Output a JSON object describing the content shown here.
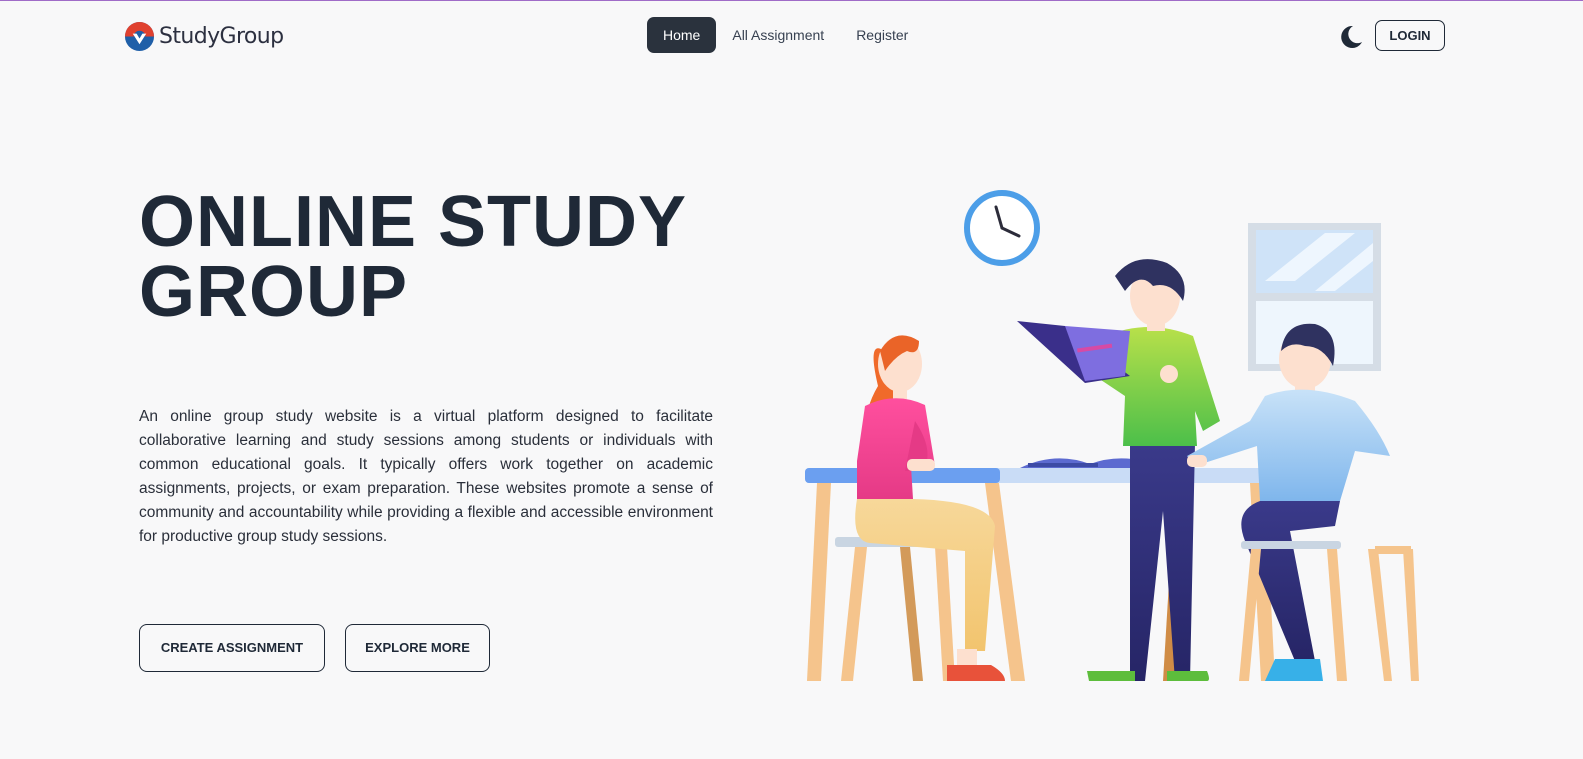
{
  "navbar": {
    "logo_text": "StudyGroup",
    "links": [
      {
        "label": "Home",
        "active": true
      },
      {
        "label": "All Assignment",
        "active": false
      },
      {
        "label": "Register",
        "active": false
      }
    ],
    "theme_icon": "moon-icon",
    "login_label": "LOGIN"
  },
  "hero": {
    "title_line1": "ONLINE STUDY",
    "title_line2": "GROUP",
    "description": "An online group study website is a virtual platform designed to facilitate collaborative learning and study sessions among students or individuals with common educational goals. It typically offers work together on academic assignments, projects, or exam preparation. These websites promote a sense of community and accountability while providing a flexible and accessible environment for productive group study sessions.",
    "create_label": "CREATE ASSIGNMENT",
    "explore_label": "EXPLORE MORE"
  },
  "colors": {
    "background": "#f8f8f9",
    "text_dark": "#1f2937",
    "nav_active": "#2a323d",
    "top_border": "#a06cc8"
  }
}
